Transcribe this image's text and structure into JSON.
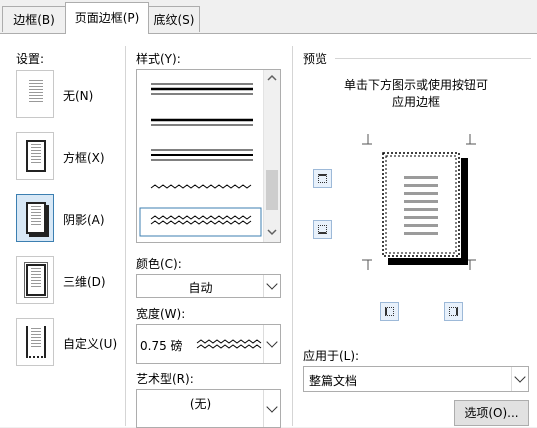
{
  "tabs": [
    {
      "label": "边框(B)"
    },
    {
      "label": "页面边框(P)"
    },
    {
      "label": "底纹(S)"
    }
  ],
  "settings": {
    "heading": "设置:",
    "items": [
      {
        "label": "无(N)"
      },
      {
        "label": "方框(X)"
      },
      {
        "label": "阴影(A)"
      },
      {
        "label": "三维(D)"
      },
      {
        "label": "自定义(U)"
      }
    ],
    "selected": "阴影(A)"
  },
  "style": {
    "heading": "样式(Y):",
    "options": [
      "thin-thick-thin",
      "thick-thin",
      "thin-thick-thin-small",
      "wavy",
      "double-wavy"
    ],
    "selected": "double-wavy"
  },
  "color": {
    "label": "颜色(C):",
    "value": "自动"
  },
  "width": {
    "label": "宽度(W):",
    "value": "0.75 磅"
  },
  "art": {
    "label": "艺术型(R):",
    "value": "(无)"
  },
  "preview": {
    "heading": "预览",
    "hint_line1": "单击下方图示或使用按钮可",
    "hint_line2": "应用边框"
  },
  "apply_to": {
    "label": "应用于(L):",
    "value": "整篇文档"
  },
  "options_button": "选项(O)..."
}
